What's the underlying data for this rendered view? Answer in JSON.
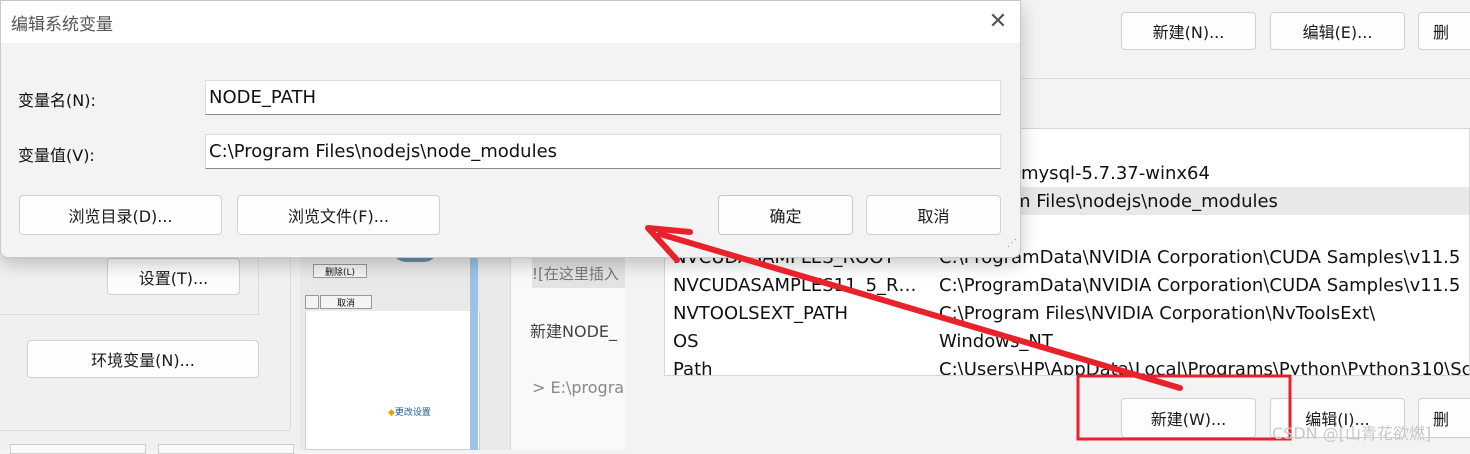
{
  "dialog": {
    "title": "编辑系统变量",
    "close_glyph": "✕",
    "name_label": "变量名(N):",
    "name_value": "NODE_PATH",
    "value_label": "变量值(V):",
    "value_value": "C:\\Program Files\\nodejs\\node_modules",
    "browse_dir_label": "浏览目录(D)...",
    "browse_file_label": "浏览文件(F)...",
    "ok_label": "确定",
    "cancel_label": "取消"
  },
  "env_window": {
    "top_new_label": "新建(N)...",
    "top_edit_label": "编辑(E)...",
    "top_delete_label": "删",
    "bottom_new_label": "新建(W)...",
    "bottom_edit_label": "编辑(I)...",
    "bottom_delete_label": "删",
    "system_vars": [
      {
        "name": "",
        "value": "mysql-5.7.37-winx64"
      },
      {
        "name": "",
        "value": "m Files\\nodejs\\node_modules"
      },
      {
        "name": "NVCUDASAMPLES_ROOT",
        "value": "C:\\ProgramData\\NVIDIA Corporation\\CUDA Samples\\v11.5"
      },
      {
        "name": "NVCUDASAMPLES11_5_RO...",
        "value": "C:\\ProgramData\\NVIDIA Corporation\\CUDA Samples\\v11.5"
      },
      {
        "name": "NVTOOLSEXT_PATH",
        "value": "C:\\Program Files\\NVIDIA Corporation\\NvToolsExt\\"
      },
      {
        "name": "OS",
        "value": "Windows_NT"
      },
      {
        "name": "Path",
        "value": "C:\\Users\\HP\\AppData\\Local\\Programs\\Python\\Python310\\Scri"
      }
    ]
  },
  "system_props": {
    "settings_label": "设置(T)...",
    "env_vars_label": "环境变量(N)..."
  },
  "thumbnail": {
    "delete_label": "删除(L)",
    "cancel_label": "取消",
    "change_settings_label": "更改设置"
  },
  "doc": {
    "insert_text": "![在这里插入",
    "new_node_text": "新建NODE_",
    "quote_text": "> E:\\progran"
  },
  "watermark": "CSDN @[山青花欲燃]",
  "colors": {
    "annotation_red": "#e8222b",
    "highlight_row": "#e8e8e8"
  }
}
